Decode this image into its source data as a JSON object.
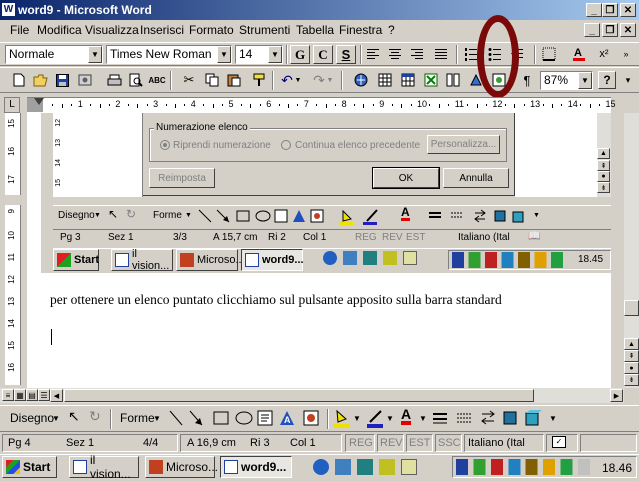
{
  "window": {
    "title": "word9 - Microsoft Word"
  },
  "menu": [
    "File",
    "Modifica",
    "Visualizza",
    "Inserisci",
    "Formato",
    "Strumenti",
    "Tabella",
    "Finestra",
    "?"
  ],
  "formatting": {
    "style": "Normale",
    "font": "Times New Roman",
    "size": "14",
    "bold": "G",
    "italic": "C",
    "underline": "S"
  },
  "standard": {
    "zoom": "87%"
  },
  "dialog": {
    "group_label": "Numerazione elenco",
    "option1": "Riprendi numerazione",
    "option2": "Continua elenco precedente",
    "personalize": "Personalizza...",
    "reset": "Reimposta",
    "ok": "OK",
    "cancel": "Annulla"
  },
  "drawing_inner": {
    "draw": "Disegno",
    "shapes": "Forme"
  },
  "status_inner": {
    "page": "Pg 3",
    "section": "Sez 1",
    "pages": "3/3",
    "at": "A 15,7 cm",
    "line": "Ri 2",
    "col": "Col 1",
    "reg": "REG",
    "rev": "REV",
    "est": "EST",
    "lang": "Italiano (Ital"
  },
  "taskbar_inner": {
    "start": "Start",
    "task1": "il vision...",
    "task2": "Microso...",
    "task3": "word9...",
    "clock": "18.45"
  },
  "document": {
    "text": "per ottenere un elenco puntato clicchiamo sul pulsante apposito sulla barra standard"
  },
  "drawing": {
    "draw": "Disegno",
    "shapes": "Forme"
  },
  "status": {
    "page": "Pg 4",
    "section": "Sez 1",
    "pages": "4/4",
    "at": "A 16,9 cm",
    "line": "Ri 3",
    "col": "Col 1",
    "reg": "REG",
    "rev": "REV",
    "est": "EST",
    "ssc": "SSC",
    "lang": "Italiano (Ital"
  },
  "taskbar": {
    "start": "Start",
    "task1": "il vision...",
    "task2": "Microso...",
    "task3": "word9...",
    "clock": "18.46"
  },
  "ruler_numbers": [
    "1",
    "2",
    "3",
    "4",
    "5",
    "6",
    "7",
    "8",
    "9",
    "10",
    "11",
    "12",
    "13",
    "14",
    "15"
  ],
  "colors": {
    "title_start": "#0a246a",
    "title_end": "#a6caf0",
    "annotation": "#7a0a0a"
  }
}
